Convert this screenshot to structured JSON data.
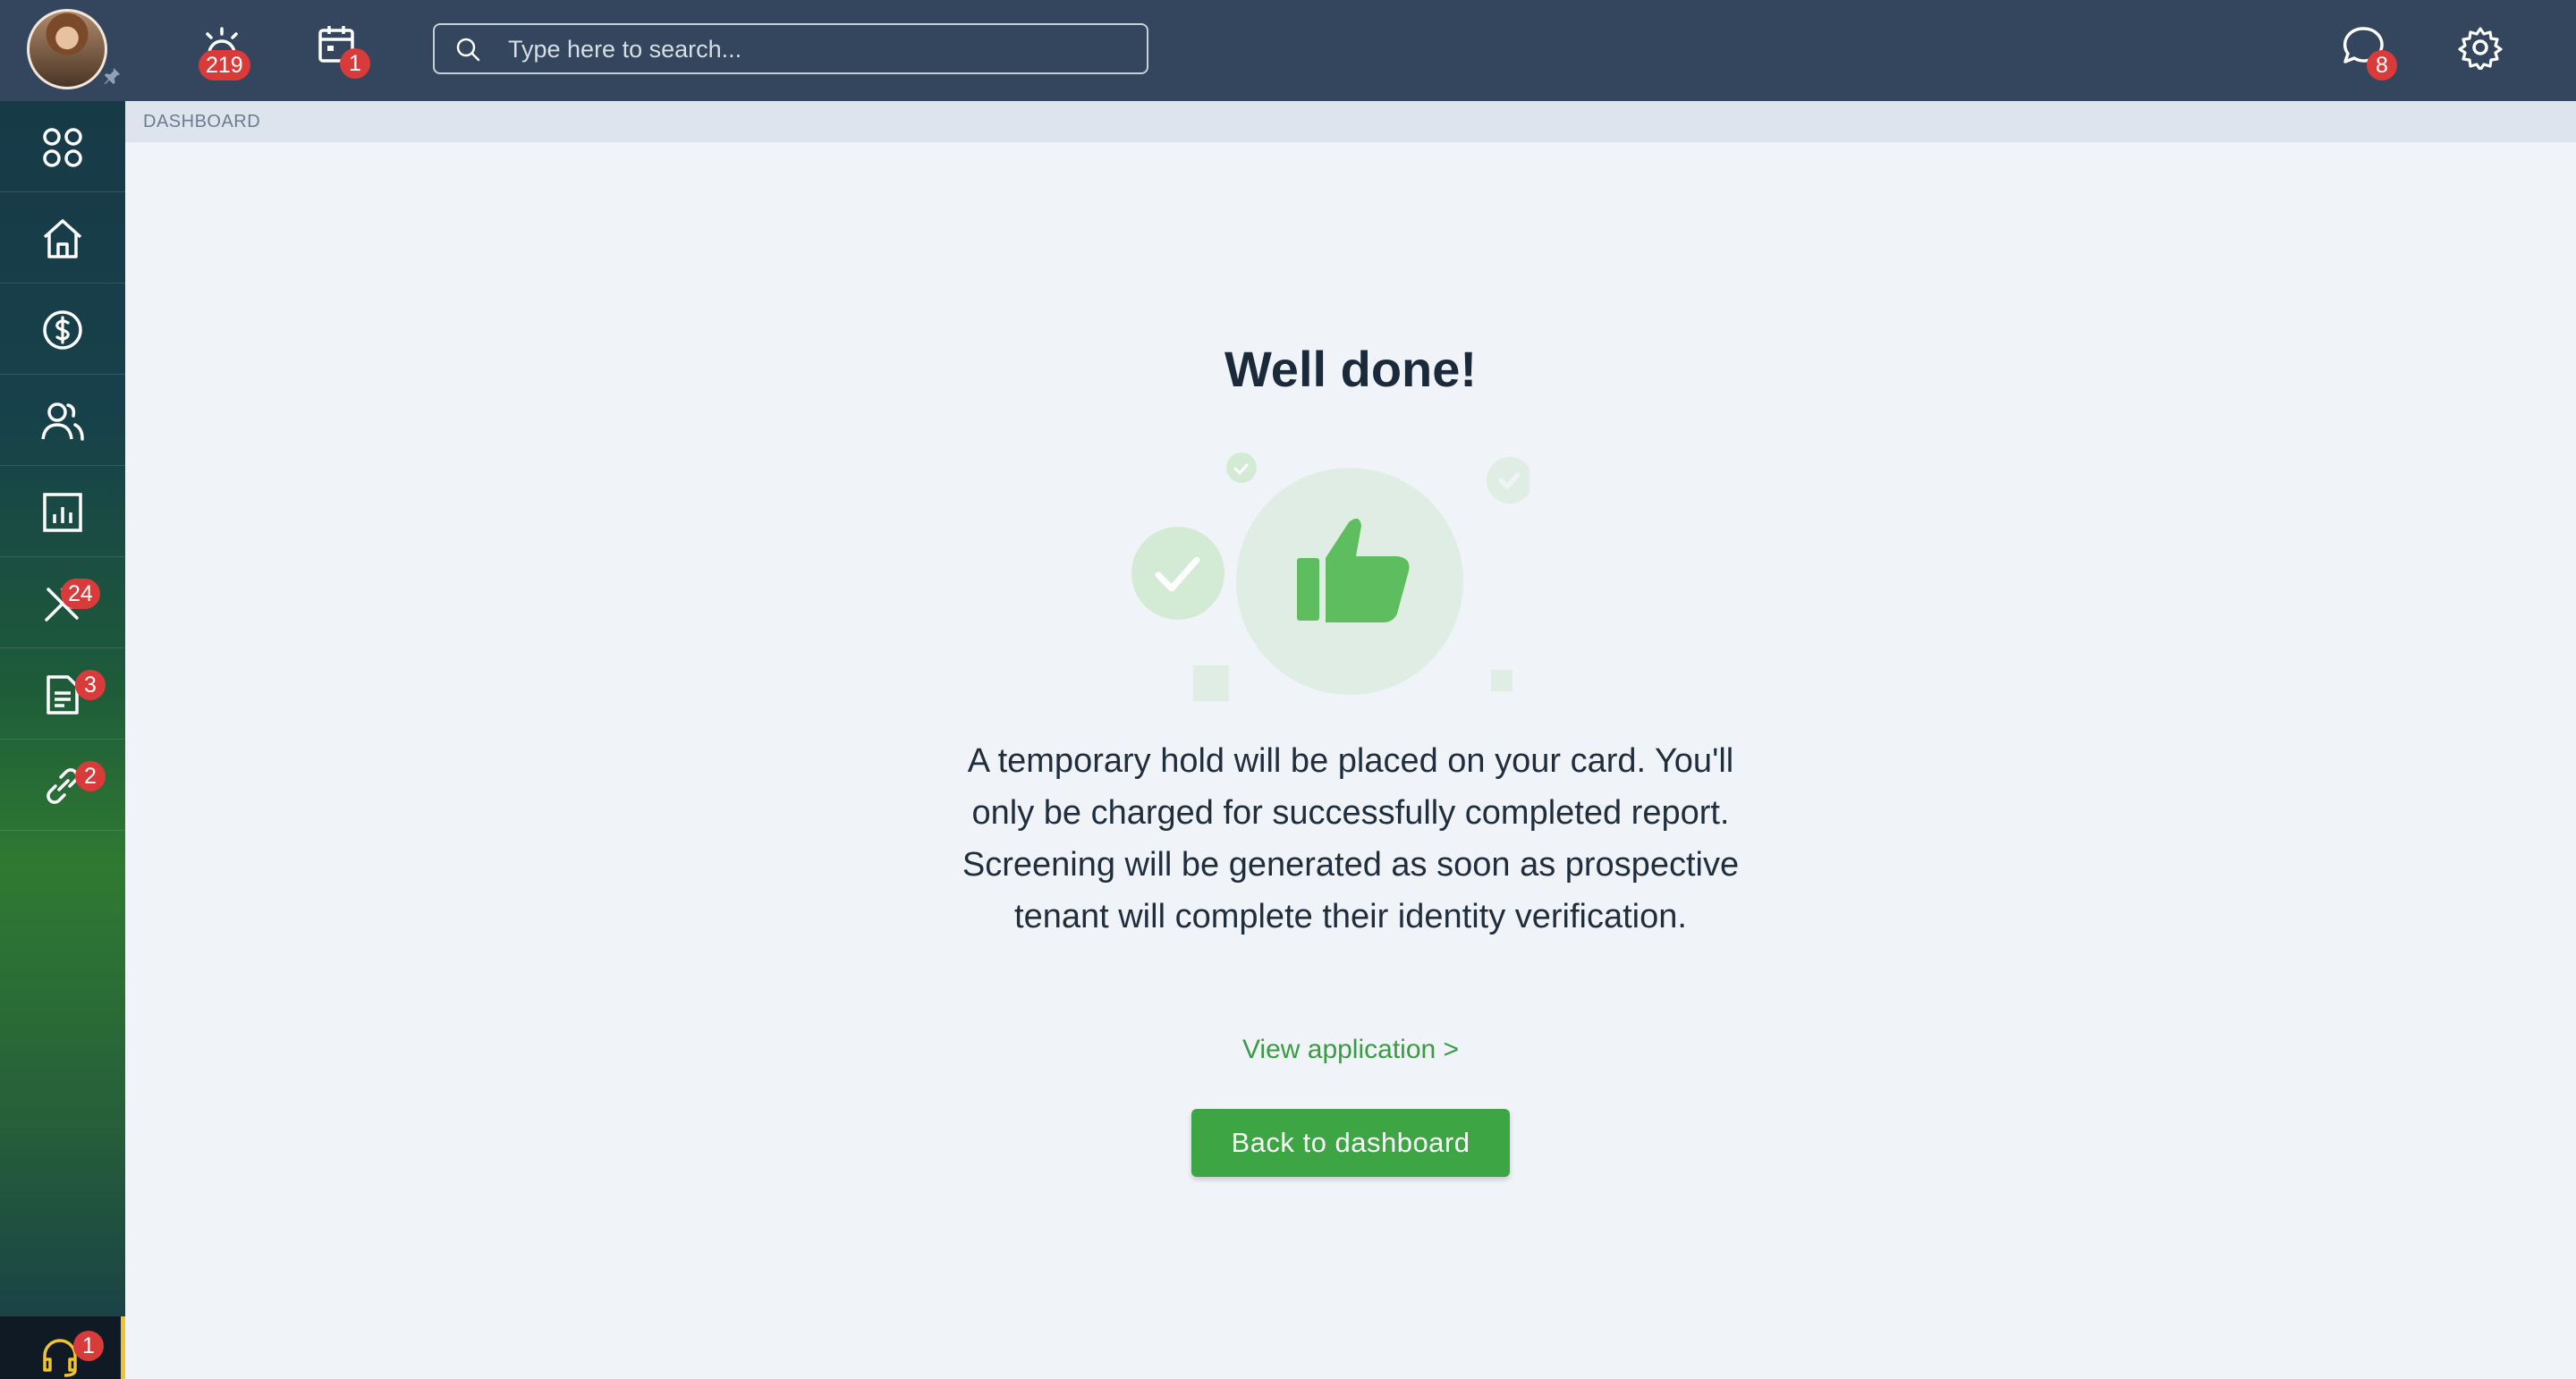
{
  "header": {
    "search_placeholder": "Type here to search...",
    "alerts_badge": "219",
    "calendar_badge": "1",
    "messages_badge": "8"
  },
  "sidebar": {
    "maintenance_badge": "24",
    "documents_badge": "3",
    "links_badge": "2",
    "support_badge": "1"
  },
  "breadcrumb": "DASHBOARD",
  "main": {
    "title": "Well done!",
    "message": "A temporary hold will be placed on your card. You'll only be charged for successfully completed report. Screening will be generated as soon as prospective tenant will complete their identity verification.",
    "view_link": "View application >",
    "back_button": "Back to dashboard"
  },
  "colors": {
    "topbar": "#33465e",
    "accent_green": "#3ea544",
    "badge_red": "#d93a3a"
  }
}
